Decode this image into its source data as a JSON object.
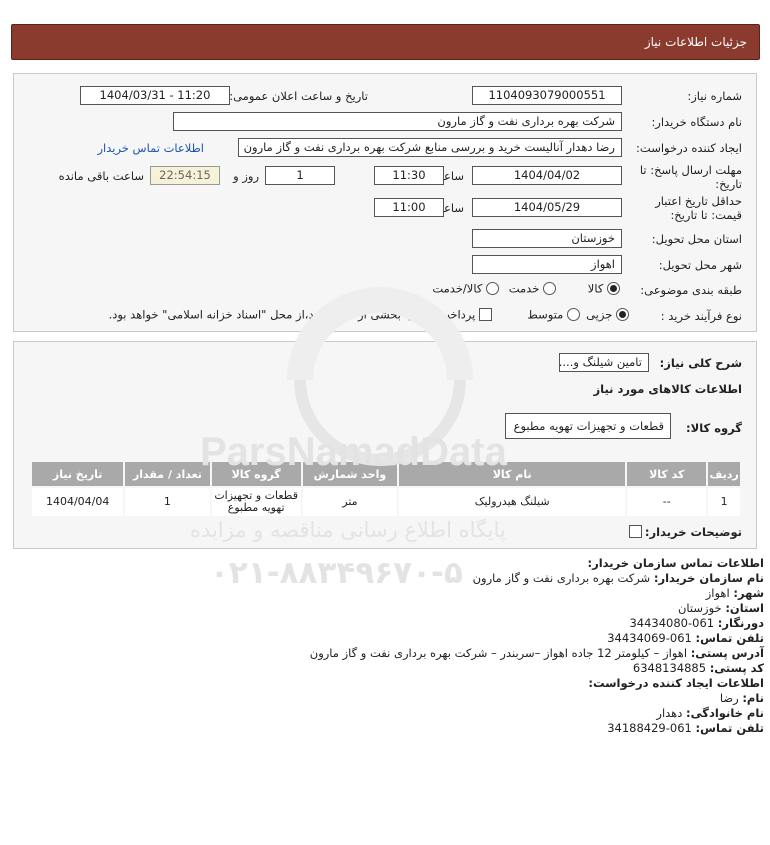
{
  "header": {
    "title": "جزئیات اطلاعات نیاز"
  },
  "details": {
    "need_number_label": "شماره نیاز:",
    "need_number": "1104093079000551",
    "announce_label": "تاریخ و ساعت اعلان عمومی:",
    "announce_value": "1404/03/31 - 11:20",
    "buyer_org_label": "نام دستگاه خریدار:",
    "buyer_org": "شرکت بهره برداری نفت و گاز مارون",
    "creator_label": "ایجاد کننده درخواست:",
    "creator": "رضا دهدار آنالیست خرید و بررسی منابع شرکت بهره برداری نفت و گاز مارون",
    "contact_link": "اطلاعات تماس خریدار",
    "reply_deadline_label_1": "مهلت ارسال پاسخ: تا",
    "reply_deadline_label_2": "تاریخ:",
    "reply_date": "1404/04/02",
    "time_label": "ساعت",
    "reply_time": "11:30",
    "days_value": "1",
    "days_label": "روز و",
    "remaining_value": "22:54:15",
    "remaining_label": "ساعت باقی مانده",
    "price_validity_label_1": "حداقل تاریخ اعتبار",
    "price_validity_label_2": "قیمت: تا تاریخ:",
    "validity_date": "1404/05/29",
    "validity_time": "11:00",
    "province_label": "استان محل تحویل:",
    "province": "خوزستان",
    "city_label": "شهر محل تحویل:",
    "city": "اهواز",
    "category_label": "طبقه بندی موضوعی:",
    "category_options": [
      "کالا",
      "خدمت",
      "کالا/خدمت"
    ],
    "category_selected": "کالا",
    "process_label": "نوع فرآیند خرید :",
    "process_options": [
      "جزیی",
      "متوسط"
    ],
    "process_selected": "جزیی",
    "payment_note": "پرداخت تمام یا بخشی از مبلغ خرید،از محل \"اسناد خزانه اسلامی\" خواهد بود."
  },
  "goods": {
    "description_label": "شرح کلی نیاز:",
    "description": "تامین شیلنگ و....",
    "info_title": "اطلاعات کالاهای مورد نیاز",
    "group_label": "گروه کالا:",
    "group_value": "قطعات و تجهیزات تهویه مطبوع",
    "columns": [
      "ردیف",
      "کد کالا",
      "نام کالا",
      "واحد شمارش",
      "گروه کالا",
      "تعداد / مقدار",
      "تاریخ نیاز"
    ],
    "rows": [
      [
        "1",
        "--",
        "شیلنگ هیدرولیک",
        "متر",
        "قطعات و تجهیزات تهویه مطبوع",
        "1",
        "1404/04/04"
      ]
    ],
    "buyer_notes_label": "توضیحات خریدار:"
  },
  "contact": {
    "title": "اطلاعات تماس سازمان خریدار:",
    "org_label": "نام سازمان خریدار:",
    "org_value": "شرکت بهره برداری نفت و گاز مارون",
    "city_label": "شهر:",
    "city_value": "اهواز",
    "province_label": "استان:",
    "province_value": "خوزستان",
    "fax_label": "دورنگار:",
    "fax_value": "061-34434080",
    "phone_label": "تلفن تماس:",
    "phone_value": "061-34434069",
    "address_label": "آدرس پستی:",
    "address_value": "اهواز – کیلومتر 12 جاده اهواز –سربندر – شرکت بهره برداری نفت و گاز مارون",
    "postal_label": "کد پستی:",
    "postal_value": "6348134885",
    "creator_title": "اطلاعات ایجاد کننده درخواست:",
    "name_label": "نام:",
    "name_value": "رضا",
    "family_label": "نام خانوادگی:",
    "family_value": "دهدار",
    "creator_phone_label": "تلفن تماس:",
    "creator_phone_value": "061-34188429"
  },
  "watermark": {
    "brand": "ParsNamadData",
    "line1": "پایگاه اطلاع رسانی مناقصه و مزایده",
    "phone": "۰۲۱-۸۸۳۴۹۶۷۰-۵"
  }
}
